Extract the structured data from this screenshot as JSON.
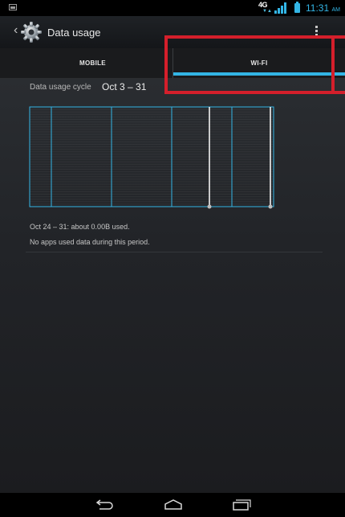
{
  "status_bar": {
    "network": "4G",
    "time": "11:31",
    "ampm": "AM",
    "accent": "#33b5e5",
    "icons": [
      "image-icon",
      "network-arrows-icon",
      "signal-icon",
      "battery-icon"
    ]
  },
  "action_bar": {
    "title": "Data usage",
    "icons": [
      "up-caret-icon",
      "settings-gear-icon",
      "overflow-menu-icon"
    ]
  },
  "tabs": [
    {
      "label": "MOBILE",
      "selected": false
    },
    {
      "label": "WI-FI",
      "selected": true
    }
  ],
  "cycle": {
    "label": "Data usage cycle",
    "value": "Oct 3 – 31"
  },
  "chart_data": {
    "type": "area",
    "series": [
      {
        "values": [
          0,
          0,
          0,
          0,
          0,
          0,
          0,
          0,
          0,
          0,
          0,
          0,
          0,
          0,
          0,
          0,
          0,
          0,
          0,
          0,
          0,
          0,
          0,
          0,
          0,
          0,
          0,
          0,
          0
        ]
      }
    ],
    "grid": true,
    "vertical_divisions": 5,
    "inspection_range": [
      "Oct 24",
      "Oct 31"
    ],
    "colors": {
      "grid": "#33b5e5",
      "sweep": "#ffffff"
    }
  },
  "summary": "Oct 24 – 31: about 0.00B used.",
  "no_apps": "No apps used data during this period.",
  "nav_bar": {
    "icons": [
      "back-icon",
      "home-icon",
      "recent-apps-icon"
    ]
  },
  "annotation": {
    "color": "#d41f2b"
  }
}
